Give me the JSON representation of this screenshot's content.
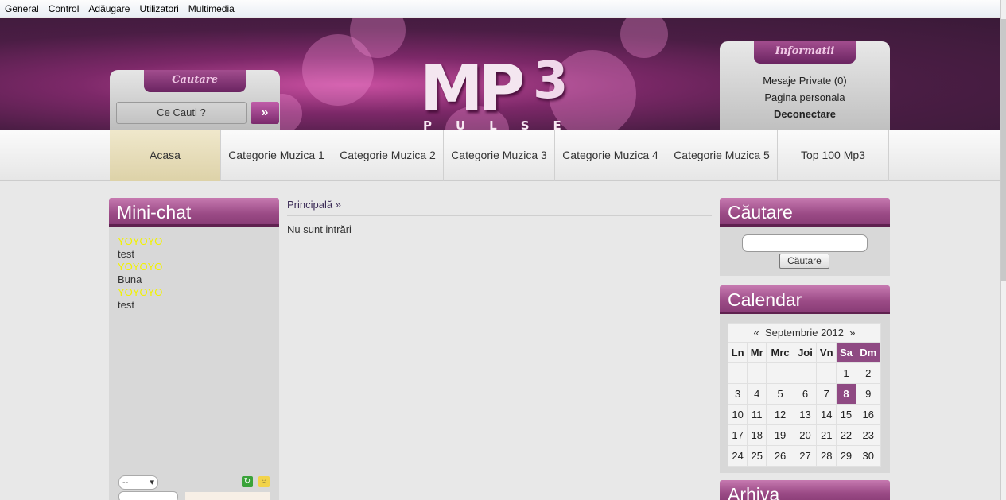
{
  "admin_bar": {
    "items": [
      "General",
      "Control",
      "Adăugare",
      "Utilizatori",
      "Multimedia"
    ]
  },
  "header": {
    "logo_main": "MP",
    "logo_three": "3",
    "logo_sub": "PULSE",
    "search": {
      "tab_title": "Cautare",
      "placeholder": "Ce Cauti ?",
      "go": "»"
    },
    "info": {
      "tab_title": "Informatii",
      "links": [
        "Mesaje Private (0)",
        "Pagina personala",
        "Deconectare"
      ]
    }
  },
  "nav": {
    "items": [
      "Acasa",
      "Categorie Muzica 1",
      "Categorie Muzica 2",
      "Categorie Muzica 3",
      "Categorie Muzica 4",
      "Categorie Muzica 5",
      "Top 100 Mp3"
    ],
    "active": 0
  },
  "minichat": {
    "title": "Mini-chat",
    "messages": [
      {
        "name": "YOYOYO",
        "text": "test"
      },
      {
        "name": "YOYOYO",
        "text": "Buna"
      },
      {
        "name": "YOYOYO",
        "text": "test"
      }
    ],
    "select_value": "--"
  },
  "center": {
    "breadcrumb": "Principală »",
    "empty": "Nu sunt intrări"
  },
  "right_search": {
    "title": "Căutare",
    "button": "Căutare"
  },
  "calendar": {
    "title": "Calendar",
    "month": "Septembrie 2012",
    "prev": "«",
    "next": "»",
    "days": [
      "Ln",
      "Mr",
      "Mrc",
      "Joi",
      "Vn",
      "Sa",
      "Dm"
    ],
    "weeks": [
      [
        "",
        "",
        "",
        "",
        "",
        "1",
        "2"
      ],
      [
        "3",
        "4",
        "5",
        "6",
        "7",
        "8",
        "9"
      ],
      [
        "10",
        "11",
        "12",
        "13",
        "14",
        "15",
        "16"
      ],
      [
        "17",
        "18",
        "19",
        "20",
        "21",
        "22",
        "23"
      ],
      [
        "24",
        "25",
        "26",
        "27",
        "28",
        "29",
        "30"
      ]
    ],
    "today": "8"
  },
  "archive": {
    "title": "Arhiva"
  },
  "colors": {
    "accent": "#8f4a83",
    "chat_name": "#f2f200"
  }
}
